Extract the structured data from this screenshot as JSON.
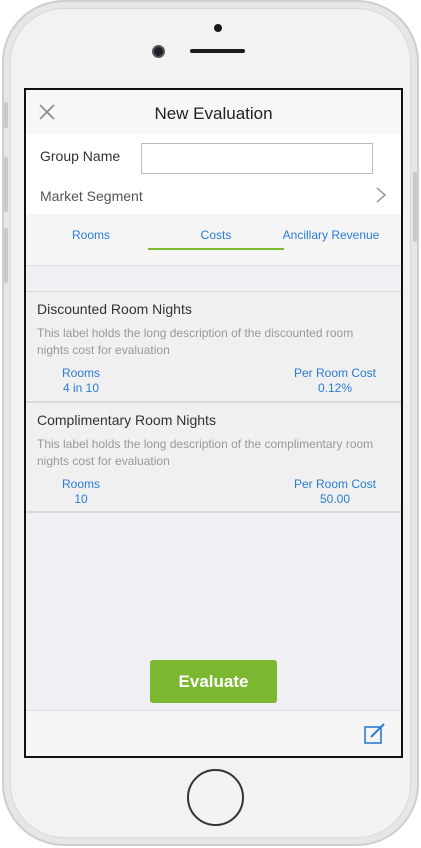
{
  "header": {
    "title": "New Evaluation"
  },
  "form": {
    "group_name_label": "Group Name",
    "group_name_value": "",
    "group_name_placeholder": "",
    "market_segment_label": "Market Segment"
  },
  "tabs": [
    {
      "label": "Rooms",
      "active": false
    },
    {
      "label": "Costs",
      "active": true
    },
    {
      "label": "Ancillary Revenue",
      "active": false
    }
  ],
  "costs": [
    {
      "title": "Discounted Room Nights",
      "description": "This label holds the long description of the discounted room nights cost for evaluation",
      "rooms_label": "Rooms",
      "rooms_value": "4 in 10",
      "cost_label": "Per Room Cost",
      "cost_value": "0.12%"
    },
    {
      "title": "Complimentary Room Nights",
      "description": "This label holds the long description of the complimentary room nights cost for evaluation",
      "rooms_label": "Rooms",
      "rooms_value": "10",
      "cost_label": "Per Room Cost",
      "cost_value": "50.00"
    }
  ],
  "actions": {
    "evaluate_label": "Evaluate"
  },
  "colors": {
    "accent_green": "#7cb82f",
    "link_blue": "#2a7bd5"
  },
  "icons": {
    "close": "close-icon",
    "chevron": "chevron-right-icon",
    "edit": "edit-icon"
  }
}
